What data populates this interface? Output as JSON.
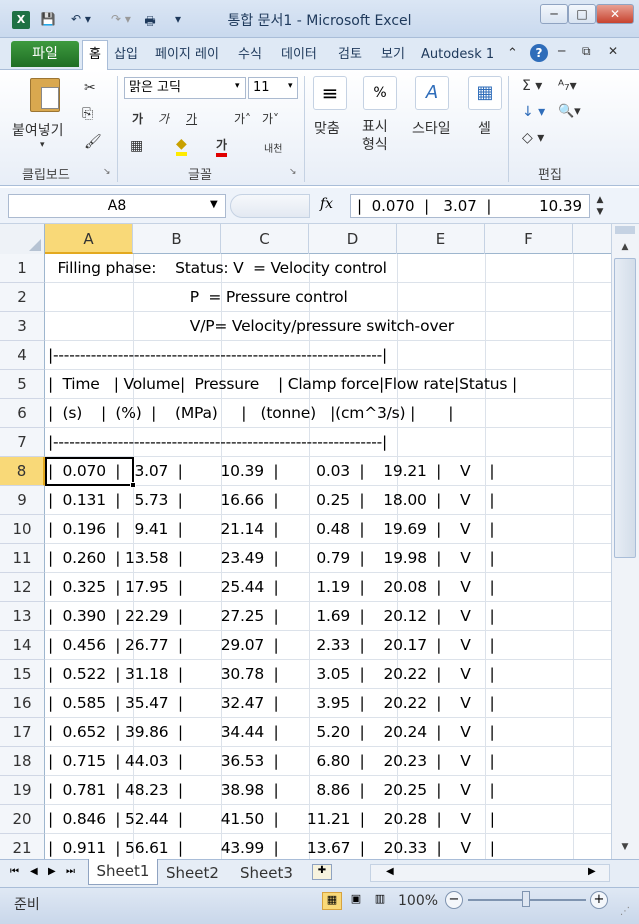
{
  "window": {
    "title": "통합 문서1  -  Microsoft Excel",
    "app_icon": "excel-icon",
    "qa_save": "💾",
    "qa_undo": "↶ ▾",
    "qa_redo": "↷ ▾",
    "qa_print": "🖶",
    "qa_more": "▾",
    "minimize": "─",
    "maximize": "□",
    "close": "✕",
    "help": "?",
    "ribbon_min": "⌃",
    "restore": "⧉",
    "close_doc": "✕"
  },
  "tabs": {
    "file": "파일",
    "home": "홈",
    "items": [
      "삽입",
      "페이지 레이",
      "수식",
      "데이터",
      "검토",
      "보기",
      "Autodesk 1"
    ]
  },
  "ribbon": {
    "clipboard": {
      "paste": "붙여넣기",
      "cut": "✂",
      "copy": "⎘",
      "format_painter": "🖌",
      "label": "클립보드"
    },
    "font": {
      "name": "맑은 고딕",
      "size": "11",
      "bold": "가",
      "italic": "가",
      "underline": "가",
      "grow": "가˄",
      "shrink": "가˅",
      "border": "▦",
      "fill": "◆",
      "color": "가",
      "phonetic": "내천",
      "label": "글꼴"
    },
    "align": {
      "label": "맞춤",
      "icon": "≡"
    },
    "number": {
      "label": "표시\n형식",
      "icon": "%"
    },
    "style": {
      "label": "스타일",
      "icon": "A"
    },
    "cells": {
      "label": "셀",
      "icon": "▦"
    },
    "edit": {
      "sum": "Σ ▾",
      "fill": "↓ ▾",
      "clear": "◇ ▾",
      "sort": "ᴬ₇▾",
      "find": "🔍▾",
      "label": "편집"
    }
  },
  "formula_bar": {
    "name_box": "A8",
    "fx": "fx",
    "content": "|  0.070  |   3.07  |          10.39  |"
  },
  "columns": [
    "A",
    "B",
    "C",
    "D",
    "E",
    "F"
  ],
  "rows": [
    {
      "n": "1",
      "text": "  Filling phase:    Status: V  = Velocity control"
    },
    {
      "n": "2",
      "text": "                              P  = Pressure control"
    },
    {
      "n": "3",
      "text": "                              V/P= Velocity/pressure switch-over"
    },
    {
      "n": "4",
      "text": "|-------------------------------------------------------------|"
    },
    {
      "n": "5",
      "text": "|  Time   | Volume|  Pressure    | Clamp force|Flow rate|Status |"
    },
    {
      "n": "6",
      "text": "|  (s)    |  (%)  |    (MPa)     |   (tonne)   |(cm^3/s) |       |"
    },
    {
      "n": "7",
      "text": "|-------------------------------------------------------------|"
    },
    {
      "n": "8",
      "text": "|  0.070  |   3.07  |        10.39  |        0.03  |    19.21  |    V    |"
    },
    {
      "n": "9",
      "text": "|  0.131  |   5.73  |        16.66  |        0.25  |    18.00  |    V    |"
    },
    {
      "n": "10",
      "text": "|  0.196  |   9.41  |        21.14  |        0.48  |    19.69  |    V    |"
    },
    {
      "n": "11",
      "text": "|  0.260  | 13.58  |        23.49  |        0.79  |    19.98  |    V    |"
    },
    {
      "n": "12",
      "text": "|  0.325  | 17.95  |        25.44  |        1.19  |    20.08  |    V    |"
    },
    {
      "n": "13",
      "text": "|  0.390  | 22.29  |        27.25  |        1.69  |    20.12  |    V    |"
    },
    {
      "n": "14",
      "text": "|  0.456  | 26.77  |        29.07  |        2.33  |    20.17  |    V    |"
    },
    {
      "n": "15",
      "text": "|  0.522  | 31.18  |        30.78  |        3.05  |    20.22  |    V    |"
    },
    {
      "n": "16",
      "text": "|  0.585  | 35.47  |        32.47  |        3.95  |    20.22  |    V    |"
    },
    {
      "n": "17",
      "text": "|  0.652  | 39.86  |        34.44  |        5.20  |    20.24  |    V    |"
    },
    {
      "n": "18",
      "text": "|  0.715  | 44.03  |        36.53  |        6.80  |    20.23  |    V    |"
    },
    {
      "n": "19",
      "text": "|  0.781  | 48.23  |        38.98  |        8.86  |    20.25  |    V    |"
    },
    {
      "n": "20",
      "text": "|  0.846  | 52.44  |        41.50  |      11.21  |    20.28  |    V    |"
    },
    {
      "n": "21",
      "text": "|  0.911  | 56.61  |        43.99  |      13.67  |    20.33  |    V    |"
    }
  ],
  "sheets": [
    "Sheet1",
    "Sheet2",
    "Sheet3"
  ],
  "sheet_nav": [
    "⏮",
    "◀",
    "▶",
    "⏭"
  ],
  "status": {
    "ready": "준비",
    "zoom": "100%",
    "zoom_out": "−",
    "zoom_in": "+"
  },
  "colors": {
    "accent": "#217346",
    "active_header": "#f9d978",
    "selection": "#000000"
  }
}
